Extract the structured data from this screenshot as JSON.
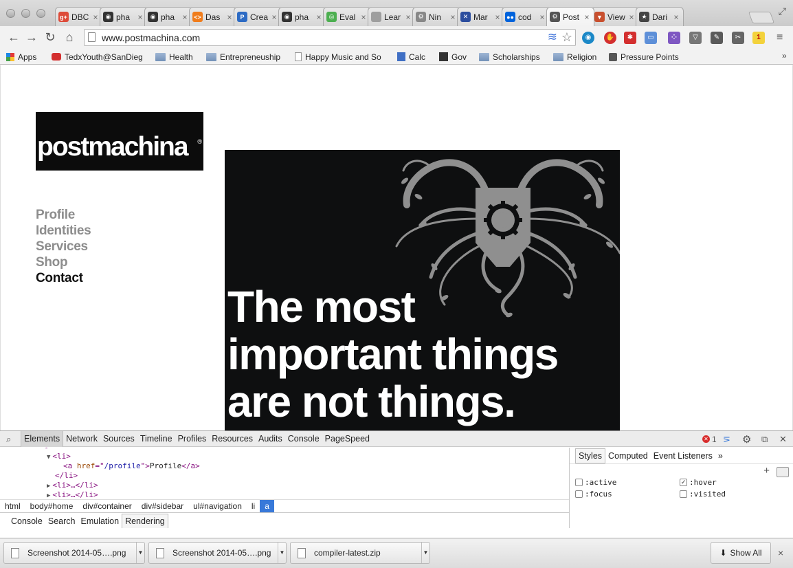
{
  "window": {
    "tabs": [
      {
        "label": "DBC",
        "color": "#dd4b39",
        "glyph": "g+"
      },
      {
        "label": "pha",
        "color": "#333333",
        "glyph": "◉"
      },
      {
        "label": "pha",
        "color": "#333333",
        "glyph": "◉"
      },
      {
        "label": "Das",
        "color": "#f07c1b",
        "glyph": "<>"
      },
      {
        "label": "Crea",
        "color": "#2d6bc4",
        "glyph": "P"
      },
      {
        "label": "pha",
        "color": "#333333",
        "glyph": "◉"
      },
      {
        "label": "Eval",
        "color": "#4caf50",
        "glyph": "◎"
      },
      {
        "label": "Lear",
        "color": "#9e9e9e",
        "glyph": ""
      },
      {
        "label": "Nin",
        "color": "#888888",
        "glyph": "⚙"
      },
      {
        "label": "Mar",
        "color": "#2b4d9e",
        "glyph": "✕"
      },
      {
        "label": "cod",
        "color": "#0063dc",
        "glyph": "●●"
      },
      {
        "label": "Post",
        "color": "#555555",
        "glyph": "⚙",
        "active": true
      },
      {
        "label": "View",
        "color": "#c84f2e",
        "glyph": "▼"
      },
      {
        "label": "Dari",
        "color": "#444444",
        "glyph": "★"
      }
    ]
  },
  "toolbar": {
    "back": "←",
    "forward": "→",
    "reload": "↻",
    "home": "⌂",
    "url": "www.postmachina.com",
    "star_icon": "☆",
    "waves_icon": "≋",
    "menu_icon": "≡",
    "ext_badge": "1"
  },
  "bookmarks": [
    {
      "label": "Apps",
      "type": "apps"
    },
    {
      "label": "TedxYouth@SanDieg",
      "type": "youtube"
    },
    {
      "label": "Health",
      "type": "folder"
    },
    {
      "label": "Entrepreneuship",
      "type": "folder"
    },
    {
      "label": "Happy Music and So",
      "type": "page"
    },
    {
      "label": "Calc",
      "type": "calc"
    },
    {
      "label": "Gov",
      "type": "bb"
    },
    {
      "label": "Scholarships",
      "type": "folder"
    },
    {
      "label": "Religion",
      "type": "folder"
    },
    {
      "label": "Pressure Points",
      "type": "cfr"
    }
  ],
  "bookmarks_overflow": "»",
  "site": {
    "logo": "postmachina",
    "logo_mark": "®",
    "nav": [
      {
        "label": "Profile",
        "current": false
      },
      {
        "label": "Identities",
        "current": false
      },
      {
        "label": "Services",
        "current": false
      },
      {
        "label": "Shop",
        "current": false
      },
      {
        "label": "Contact",
        "current": true
      }
    ],
    "hero_lines": [
      "The most",
      "important things",
      "are not things."
    ],
    "colors": {
      "hero_bg": "#0e0f10",
      "hero_art": "#8f8f8f",
      "nav_inactive": "#8d8d8d",
      "nav_active": "#111111"
    }
  },
  "devtools": {
    "tabs": [
      "Elements",
      "Network",
      "Sources",
      "Timeline",
      "Profiles",
      "Resources",
      "Audits",
      "Console",
      "PageSpeed"
    ],
    "active_tab": "Elements",
    "error_count": "1",
    "dom": {
      "li_open": "<li>",
      "a_open": "<a ",
      "href_attr": "href",
      "href_eq": "=\"",
      "href_value": "/profile",
      "href_close": "\">",
      "link_text": "Profile",
      "a_close": "</a>",
      "li_close": "</li>",
      "li_collapsed": "<li>…</li>"
    },
    "breadcrumbs": [
      "html",
      "body#home",
      "div#container",
      "div#sidebar",
      "ul#navigation",
      "li",
      "a"
    ],
    "styles_tabs": [
      "Styles",
      "Computed",
      "Event Listeners"
    ],
    "styles_more": "»",
    "pseudo": {
      "active": {
        "label": ":active",
        "checked": false
      },
      "hover": {
        "label": ":hover",
        "checked": true
      },
      "focus": {
        "label": ":focus",
        "checked": false
      },
      "visited": {
        "label": ":visited",
        "checked": false
      }
    },
    "drawer_tabs": [
      "Console",
      "Search",
      "Emulation",
      "Rendering"
    ],
    "active_drawer_tab": "Rendering"
  },
  "downloads": {
    "items": [
      "Screenshot 2014-05….png",
      "Screenshot 2014-05….png",
      "compiler-latest.zip"
    ],
    "show_all": "Show All",
    "close": "×"
  }
}
